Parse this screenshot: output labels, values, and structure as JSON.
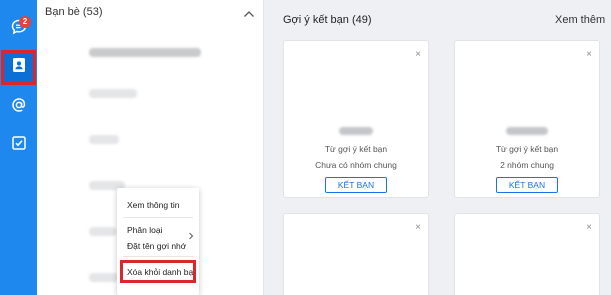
{
  "rail": {
    "chat_badge": "2",
    "accent": "#1e88ef",
    "icons": [
      "chat-icon",
      "contacts-icon",
      "at-icon",
      "todo-icon"
    ]
  },
  "friends": {
    "header": "Bạn bè (53)"
  },
  "context_menu": {
    "items": [
      "Xem thông tin",
      "Phân loại",
      "Đặt tên gợi nhớ",
      "Xóa khỏi danh bạ"
    ]
  },
  "suggestions": {
    "title": "Gợi ý kết bạn (49)",
    "see_more": "Xem thêm",
    "cards": [
      {
        "source": "Từ gợi ý kết bạn",
        "groups": "Chưa có nhóm chung",
        "button": "KẾT BẠN"
      },
      {
        "source": "Từ gợi ý kết bạn",
        "groups": "2 nhóm chung",
        "button": "KẾT BẠN"
      }
    ],
    "close_symbol": "×"
  },
  "highlight_color": "#d9272e"
}
